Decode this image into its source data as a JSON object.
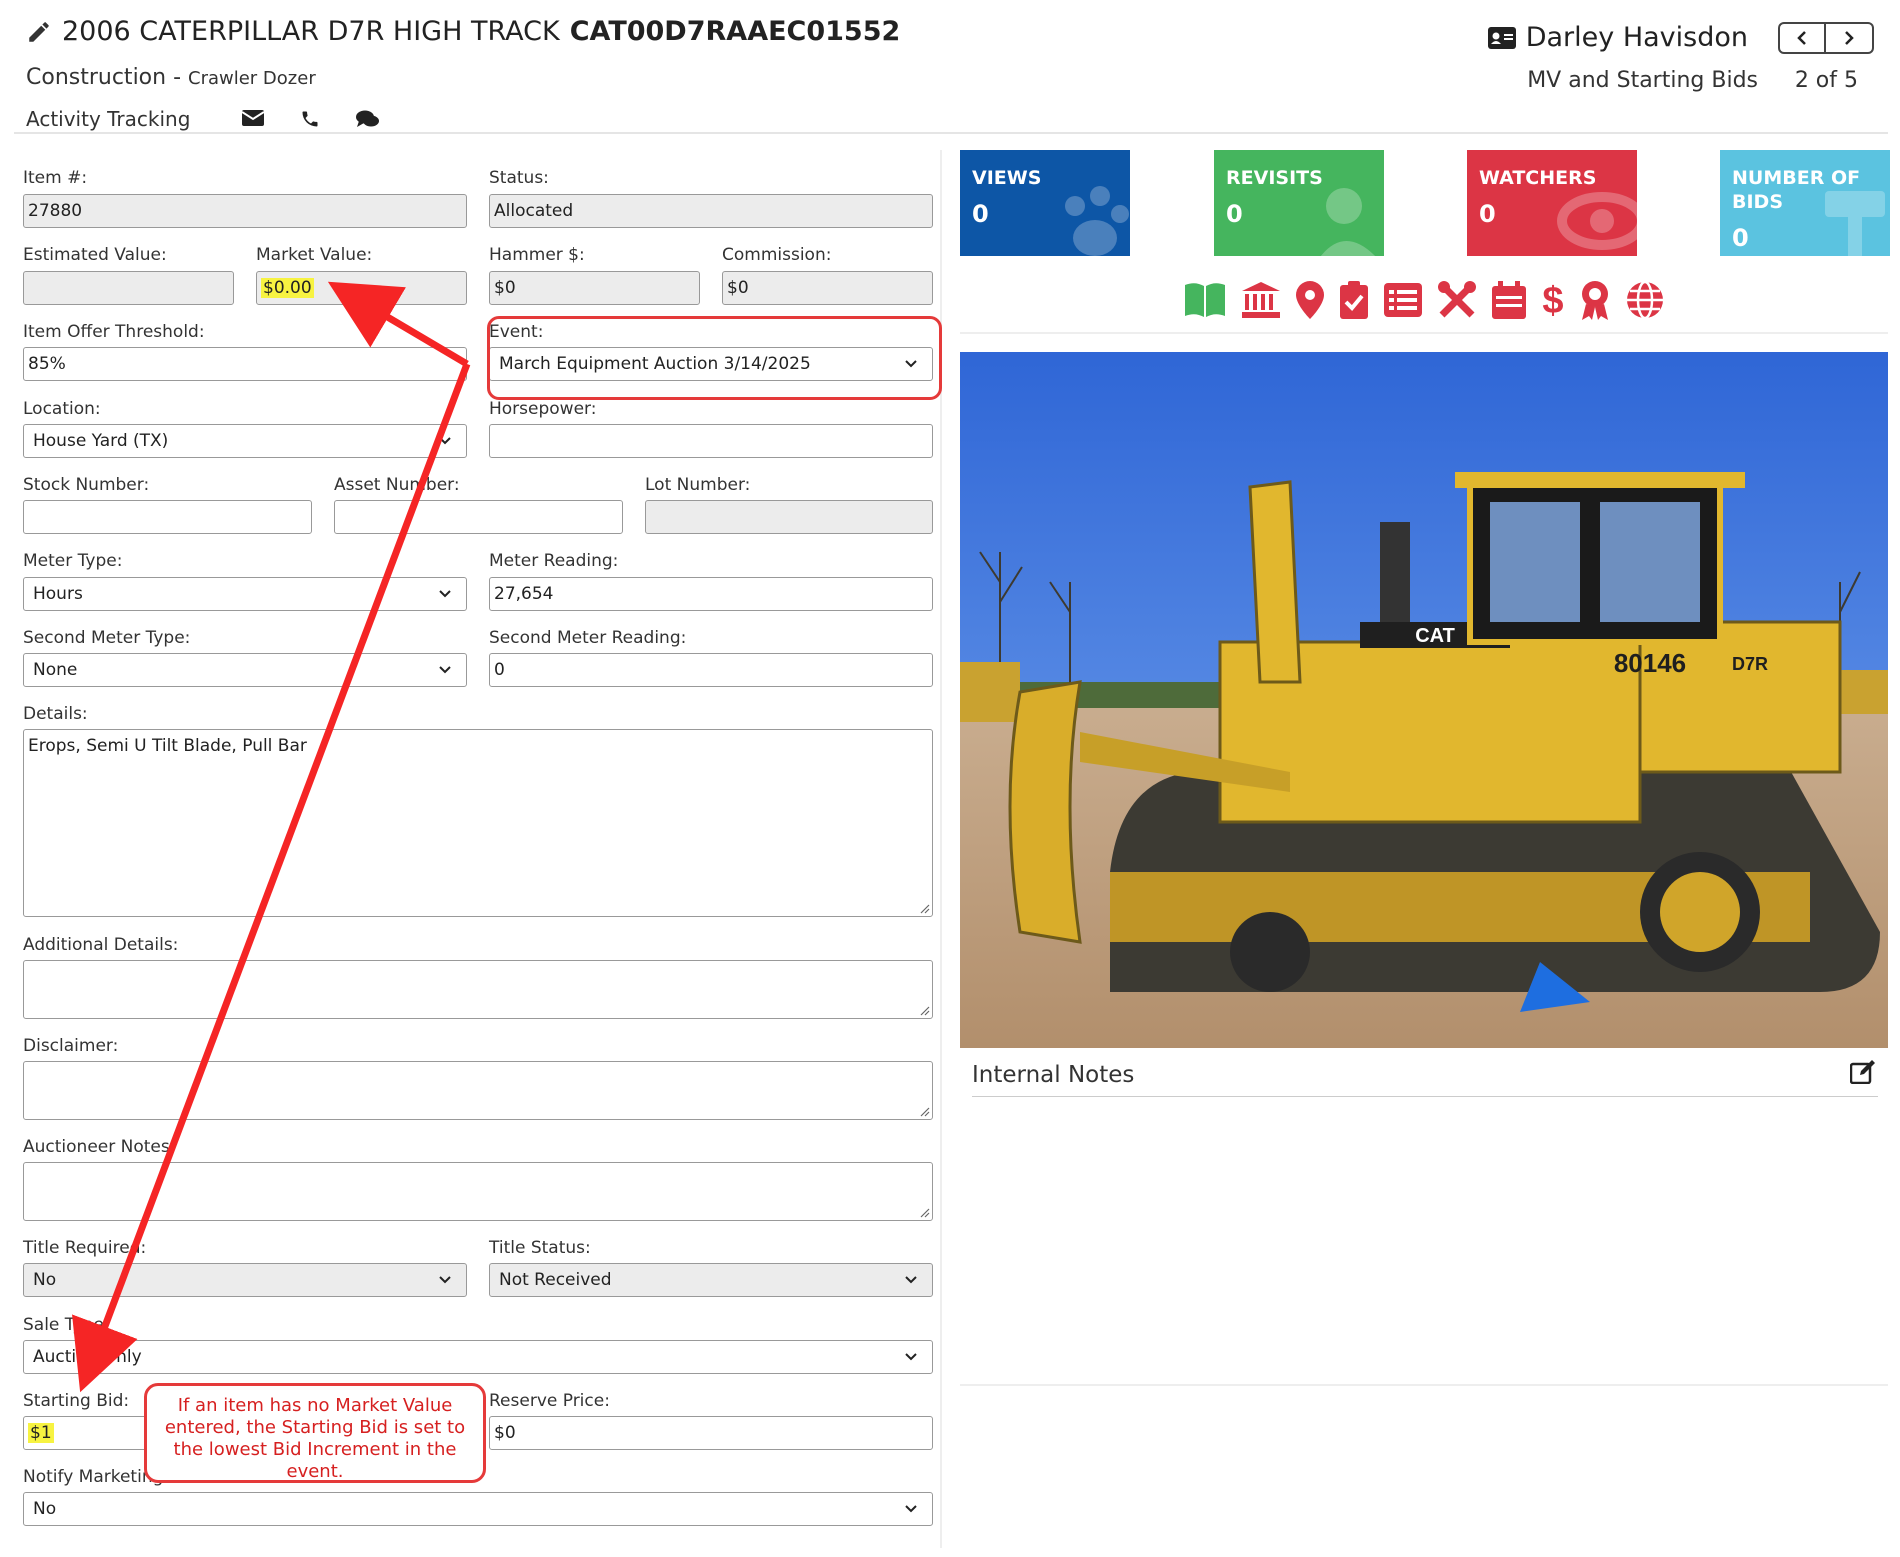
{
  "header": {
    "title_year_model": "2006 CATERPILLAR D7R HIGH TRACK",
    "title_serial": "CAT00D7RAAEC01552",
    "category": "Construction -",
    "subcategory": "Crawler Dozer",
    "activity_label": "Activity Tracking",
    "user_name": "Darley Havisdon",
    "section_title": "MV and Starting Bids",
    "pager": "2 of 5"
  },
  "form": {
    "item_number_label": "Item #:",
    "item_number_value": "27880",
    "status_label": "Status:",
    "status_value": "Allocated",
    "estimated_value_label": "Estimated Value:",
    "estimated_value": "",
    "market_value_label": "Market Value:",
    "market_value": "$0.00",
    "hammer_label": "Hammer $:",
    "hammer_value": "$0",
    "commission_label": "Commission:",
    "commission_value": "$0",
    "offer_threshold_label": "Item Offer Threshold:",
    "offer_threshold_value": "85%",
    "event_label": "Event:",
    "event_value": "March Equipment Auction 3/14/2025",
    "location_label": "Location:",
    "location_value": "House Yard (TX)",
    "horsepower_label": "Horsepower:",
    "horsepower_value": "",
    "stock_number_label": "Stock Number:",
    "asset_number_label": "Asset Number:",
    "lot_number_label": "Lot Number:",
    "meter_type_label": "Meter Type:",
    "meter_type_value": "Hours",
    "meter_reading_label": "Meter Reading:",
    "meter_reading_value": "27,654",
    "second_meter_type_label": "Second Meter Type:",
    "second_meter_type_value": "None",
    "second_meter_reading_label": "Second Meter Reading:",
    "second_meter_reading_value": "0",
    "details_label": "Details:",
    "details_value": "Erops, Semi U Tilt Blade, Pull Bar",
    "additional_details_label": "Additional Details:",
    "disclaimer_label": "Disclaimer:",
    "auctioneer_notes_label": "Auctioneer Notes:",
    "title_required_label": "Title Required:",
    "title_required_value": "No",
    "title_status_label": "Title Status:",
    "title_status_value": "Not Received",
    "sale_type_label": "Sale Type:",
    "sale_type_value": "Auction Only",
    "starting_bid_label": "Starting Bid:",
    "starting_bid_value": "$1",
    "reserve_price_label": "Reserve Price:",
    "reserve_price_value": "$0",
    "notify_marketing_label": "Notify Marketing:",
    "notify_marketing_value": "No"
  },
  "stats": [
    {
      "label_line1": "VIEWS",
      "label_line2": "",
      "value": "0",
      "color": "#0d56a6"
    },
    {
      "label_line1": "REVISITS",
      "label_line2": "",
      "value": "0",
      "color": "#45b55e"
    },
    {
      "label_line1": "WATCHERS",
      "label_line2": "",
      "value": "0",
      "color": "#dc3545"
    },
    {
      "label_line1": "NUMBER OF",
      "label_line2": "BIDS",
      "value": "0",
      "color": "#5bc3e0"
    }
  ],
  "icon_bar": {
    "icons": [
      "book-icon",
      "bank-icon",
      "map-marker-icon",
      "clipboard-check-icon",
      "list-icon",
      "tools-icon",
      "calendar-icon",
      "dollar-icon",
      "award-icon",
      "globe-icon"
    ],
    "colors": {
      "first": "#45b55e",
      "rest": "#dc3545"
    }
  },
  "notes": {
    "title": "Internal Notes"
  },
  "annotation": {
    "callout_text": "If an item has no Market Value entered, the Starting Bid is set to the lowest Bid Increment in the event.",
    "color": "#e53a3a"
  }
}
